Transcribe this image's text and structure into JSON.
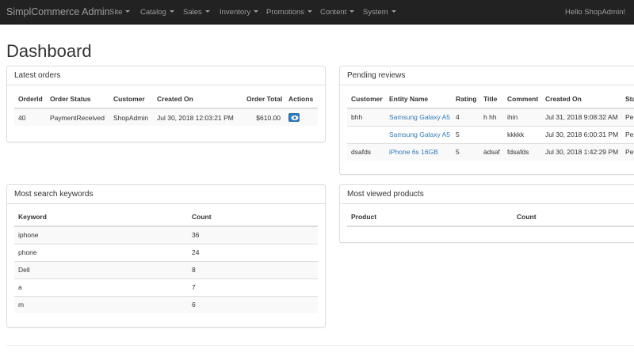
{
  "navbar": {
    "brand": "SimplCommerce Admin",
    "items": [
      "Site",
      "Catalog",
      "Sales",
      "Inventory",
      "Promotions",
      "Content",
      "System"
    ],
    "greeting": "Hello ShopAdmin!"
  },
  "page": {
    "title": "Dashboard"
  },
  "latest_orders": {
    "title": "Latest orders",
    "headers": [
      "OrderId",
      "Order Status",
      "Customer",
      "Created On",
      "Order Total",
      "Actions"
    ],
    "rows": [
      {
        "id": "40",
        "status": "PaymentReceived",
        "customer": "ShopAdmin",
        "created": "Jul 30, 2018 12:03:21 PM",
        "total": "$610.00",
        "action_icon": "eye-icon"
      }
    ]
  },
  "pending_reviews": {
    "title": "Pending reviews",
    "headers": [
      "Customer",
      "Entity Name",
      "Rating",
      "Title",
      "Comment",
      "Created On",
      "Sta"
    ],
    "rows": [
      {
        "customer": "bhh",
        "entity": "Samsung Galaxy A5",
        "rating": "4",
        "title": "h hh",
        "comment": "ihin",
        "created": "Jul 31, 2018 9:08:32 AM",
        "status": "Pen"
      },
      {
        "customer": "",
        "entity": "Samsung Galaxy A5",
        "rating": "5",
        "title": "",
        "comment": "kkkkk",
        "created": "Jul 30, 2018 6:00:31 PM",
        "status": "Pen"
      },
      {
        "customer": "dsafds",
        "entity": "iPhone 6s 16GB",
        "rating": "5",
        "title": "àdsaf",
        "comment": "fdsafds",
        "created": "Jul 30, 2018 1:42:29 PM",
        "status": "Pen"
      }
    ]
  },
  "search_keywords": {
    "title": "Most search keywords",
    "headers": [
      "Keyword",
      "Count"
    ],
    "rows": [
      {
        "keyword": "iphone",
        "count": "36"
      },
      {
        "keyword": "phone",
        "count": "24"
      },
      {
        "keyword": "Dell",
        "count": "8"
      },
      {
        "keyword": "a",
        "count": "7"
      },
      {
        "keyword": "m",
        "count": "6"
      }
    ]
  },
  "viewed_products": {
    "title": "Most viewed products",
    "headers": [
      "Product",
      "Count"
    ]
  },
  "colors": {
    "navbar_bg": "#222222",
    "nav_text": "#9d9d9d",
    "link": "#337ab7",
    "border": "#dddddd",
    "stripe": "#f9f9f9"
  }
}
